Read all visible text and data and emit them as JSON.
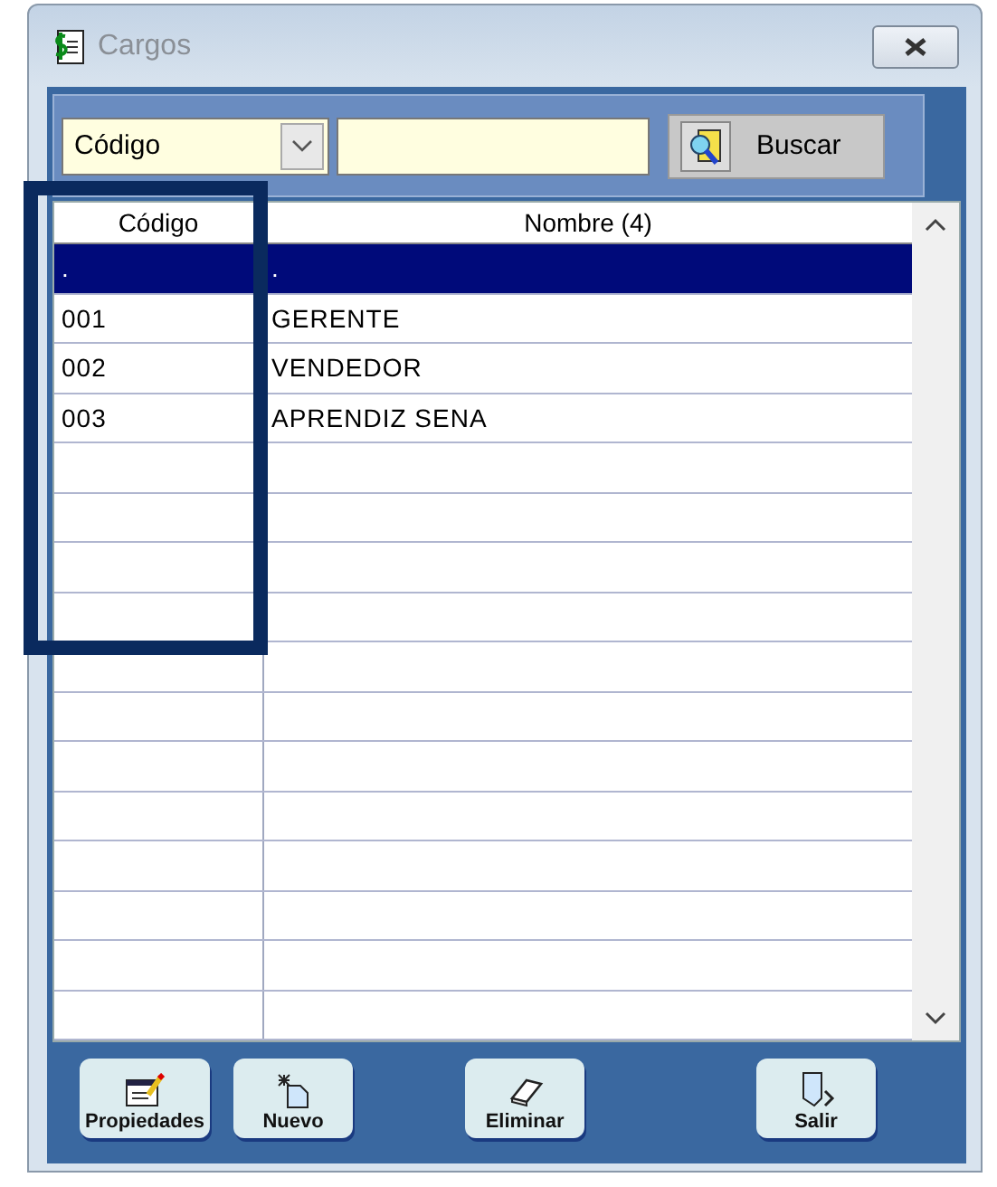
{
  "window": {
    "title": "Cargos"
  },
  "search": {
    "field_select": "Código",
    "button": "Buscar"
  },
  "table": {
    "columns": [
      "Código",
      "Nombre (4)"
    ],
    "rows": [
      {
        "cells": [
          ".",
          "."
        ],
        "selected": true
      },
      {
        "cells": [
          "001",
          "GERENTE"
        ],
        "selected": false
      },
      {
        "cells": [
          "002",
          "VENDEDOR"
        ],
        "selected": false
      },
      {
        "cells": [
          "003",
          "APRENDIZ SENA"
        ],
        "selected": false
      }
    ]
  },
  "buttons": [
    {
      "label": "Propiedades",
      "kind": "properties"
    },
    {
      "label": "Nuevo",
      "kind": "new"
    },
    {
      "label": "Eliminar",
      "kind": "delete"
    },
    {
      "label": "Salir",
      "kind": "exit"
    }
  ]
}
